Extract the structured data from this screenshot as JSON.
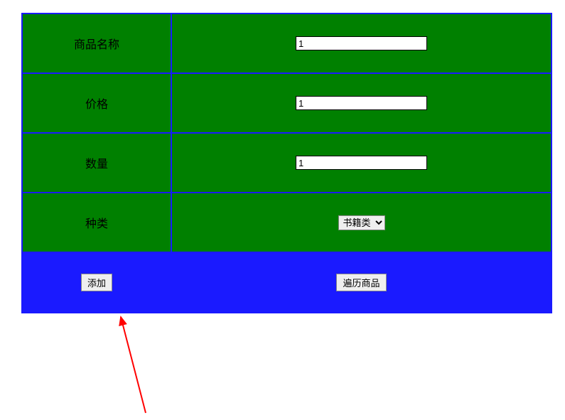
{
  "form": {
    "rows": [
      {
        "label": "商品名称",
        "value": "1"
      },
      {
        "label": "价格",
        "value": "1"
      },
      {
        "label": "数量",
        "value": "1"
      },
      {
        "label": "种类",
        "selected": "书籍类"
      }
    ],
    "buttons": {
      "add": "添加",
      "traverse": "遍历商品"
    }
  }
}
